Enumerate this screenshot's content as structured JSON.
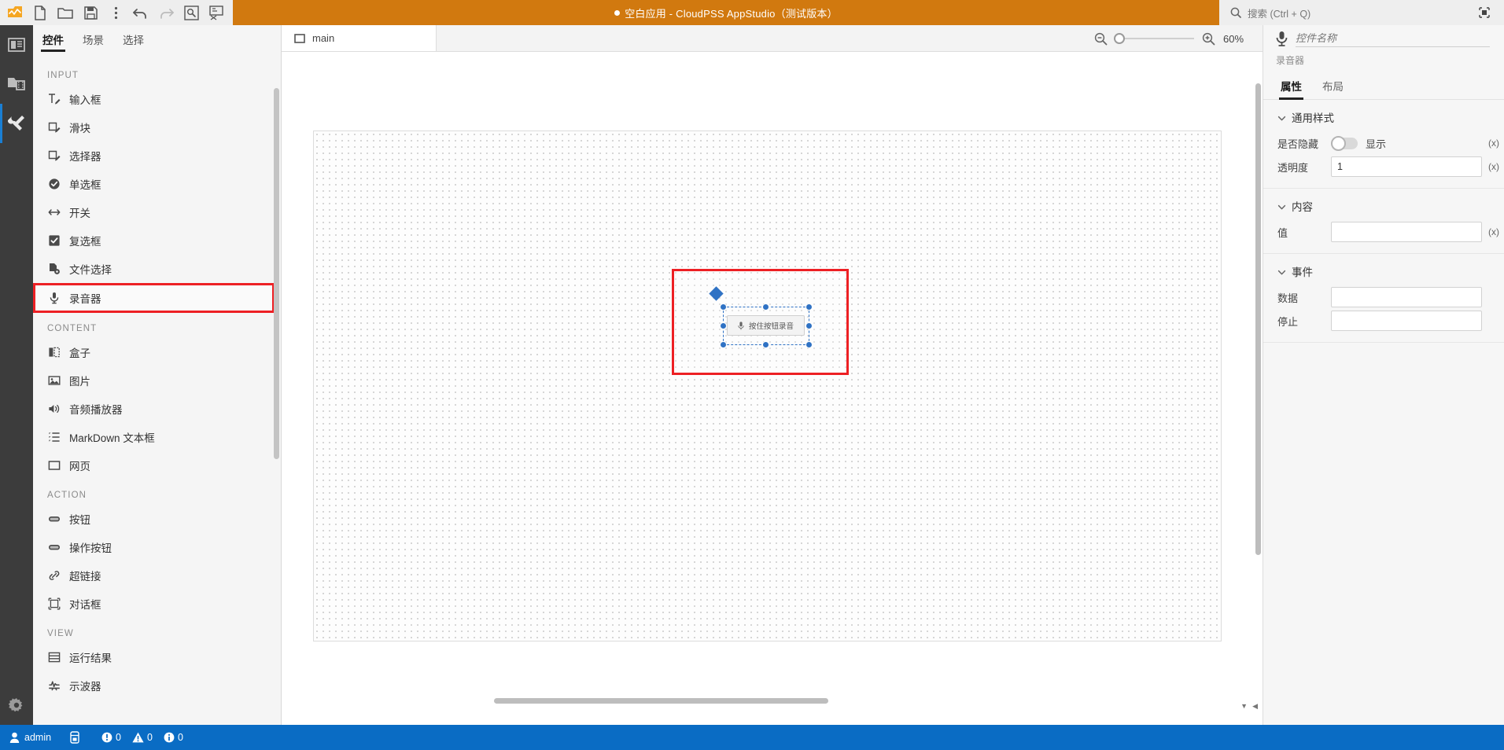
{
  "titlebar": {
    "toolbar_buttons": [
      {
        "name": "app-logo-icon",
        "label": "CloudPSS"
      },
      {
        "name": "new-file-icon",
        "label": "新建"
      },
      {
        "name": "open-folder-icon",
        "label": "打开"
      },
      {
        "name": "save-icon",
        "label": "保存"
      },
      {
        "name": "more-vertical-icon",
        "label": "更多"
      },
      {
        "name": "undo-icon",
        "label": "撤销"
      },
      {
        "name": "redo-icon",
        "label": "重做"
      },
      {
        "name": "preview-icon",
        "label": "预览"
      },
      {
        "name": "publish-icon",
        "label": "发布"
      }
    ],
    "title": "空白应用 - CloudPSS AppStudio（测试版本）",
    "search_placeholder": "搜索 (Ctrl + Q)",
    "window_button": "最大化"
  },
  "rail": {
    "items": [
      {
        "name": "rail-item-layout",
        "label": "布局",
        "active": false
      },
      {
        "name": "rail-item-media",
        "label": "资源",
        "active": false
      },
      {
        "name": "rail-item-tools",
        "label": "工具",
        "active": true
      }
    ],
    "settings_label": "设置"
  },
  "palette": {
    "tabs": [
      {
        "label": "控件",
        "active": true
      },
      {
        "label": "场景",
        "active": false
      },
      {
        "label": "选择",
        "active": false
      }
    ],
    "groups": [
      {
        "title": "INPUT",
        "items": [
          {
            "label": "输入框",
            "icon": "text-input-icon",
            "highlighted": false
          },
          {
            "label": "滑块",
            "icon": "slider-icon",
            "highlighted": false
          },
          {
            "label": "选择器",
            "icon": "select-icon",
            "highlighted": false
          },
          {
            "label": "单选框",
            "icon": "radio-icon",
            "highlighted": false
          },
          {
            "label": "开关",
            "icon": "switch-icon",
            "highlighted": false
          },
          {
            "label": "复选框",
            "icon": "checkbox-icon",
            "highlighted": false
          },
          {
            "label": "文件选择",
            "icon": "file-picker-icon",
            "highlighted": false
          },
          {
            "label": "录音器",
            "icon": "microphone-icon",
            "highlighted": true
          }
        ]
      },
      {
        "title": "CONTENT",
        "items": [
          {
            "label": "盒子",
            "icon": "box-icon",
            "highlighted": false
          },
          {
            "label": "图片",
            "icon": "image-icon",
            "highlighted": false
          },
          {
            "label": "音频播放器",
            "icon": "speaker-icon",
            "highlighted": false
          },
          {
            "label": "MarkDown 文本框",
            "icon": "markdown-icon",
            "highlighted": false
          },
          {
            "label": "网页",
            "icon": "webpage-icon",
            "highlighted": false
          }
        ]
      },
      {
        "title": "ACTION",
        "items": [
          {
            "label": "按钮",
            "icon": "button-icon",
            "highlighted": false
          },
          {
            "label": "操作按钮",
            "icon": "action-button-icon",
            "highlighted": false
          },
          {
            "label": "超链接",
            "icon": "link-icon",
            "highlighted": false
          },
          {
            "label": "对话框",
            "icon": "dialog-icon",
            "highlighted": false
          }
        ]
      },
      {
        "title": "VIEW",
        "items": [
          {
            "label": "运行结果",
            "icon": "result-table-icon",
            "highlighted": false
          },
          {
            "label": "示波器",
            "icon": "oscilloscope-icon",
            "highlighted": false
          }
        ]
      }
    ]
  },
  "center": {
    "tab": {
      "label": "main",
      "icon": "page-icon"
    },
    "zoom": {
      "out_icon": "zoom-out-icon",
      "in_icon": "zoom-in-icon",
      "percent": "60%"
    },
    "canvas": {
      "widget_button_label": "按住按钮录音",
      "widget_button_icon": "microphone-icon"
    }
  },
  "properties": {
    "name_placeholder": "控件名称",
    "name_value": "",
    "type_label": "录音器",
    "header_icon": "microphone-icon",
    "tabs": [
      {
        "label": "属性",
        "active": true
      },
      {
        "label": "布局",
        "active": false
      }
    ],
    "sections": [
      {
        "title": "通用样式",
        "rows": [
          {
            "label": "是否隐藏",
            "control": "toggle",
            "toggle_text": "显示",
            "expr": "(x)"
          },
          {
            "label": "透明度",
            "control": "input",
            "value": "1",
            "expr": "(x)"
          }
        ]
      },
      {
        "title": "内容",
        "rows": [
          {
            "label": "值",
            "control": "input",
            "value": "",
            "expr": "(x)"
          }
        ]
      },
      {
        "title": "事件",
        "rows": [
          {
            "label": "数据",
            "control": "input",
            "value": "",
            "expr": ""
          },
          {
            "label": "停止",
            "control": "input",
            "value": "",
            "expr": ""
          }
        ]
      }
    ]
  },
  "status": {
    "user": "admin",
    "db_icon": "database-icon",
    "badges": [
      {
        "icon": "error-icon",
        "count": "0"
      },
      {
        "icon": "warning-icon",
        "count": "0"
      },
      {
        "icon": "info-icon",
        "count": "0"
      }
    ]
  },
  "colors": {
    "title_bar": "#d1790f",
    "status_bar": "#0a6cc4",
    "highlight": "#ed2024",
    "selection": "#2f72c4",
    "rail": "#3c3c3c"
  }
}
